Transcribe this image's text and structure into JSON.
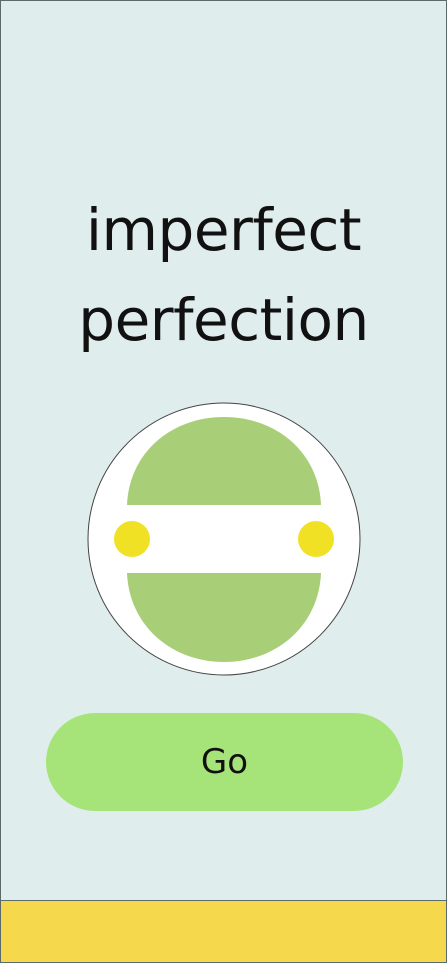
{
  "app": {
    "title_line1": "imperfect",
    "title_line2": "perfection",
    "go_label": "Go"
  },
  "logo": {
    "icon": "circle-emblem-icon"
  },
  "colors": {
    "background": "#dfeeed",
    "button": "#a6e479",
    "emblem_green": "#a8cf78",
    "dots": "#f1e125",
    "bottom_bar": "#f5d84b"
  }
}
